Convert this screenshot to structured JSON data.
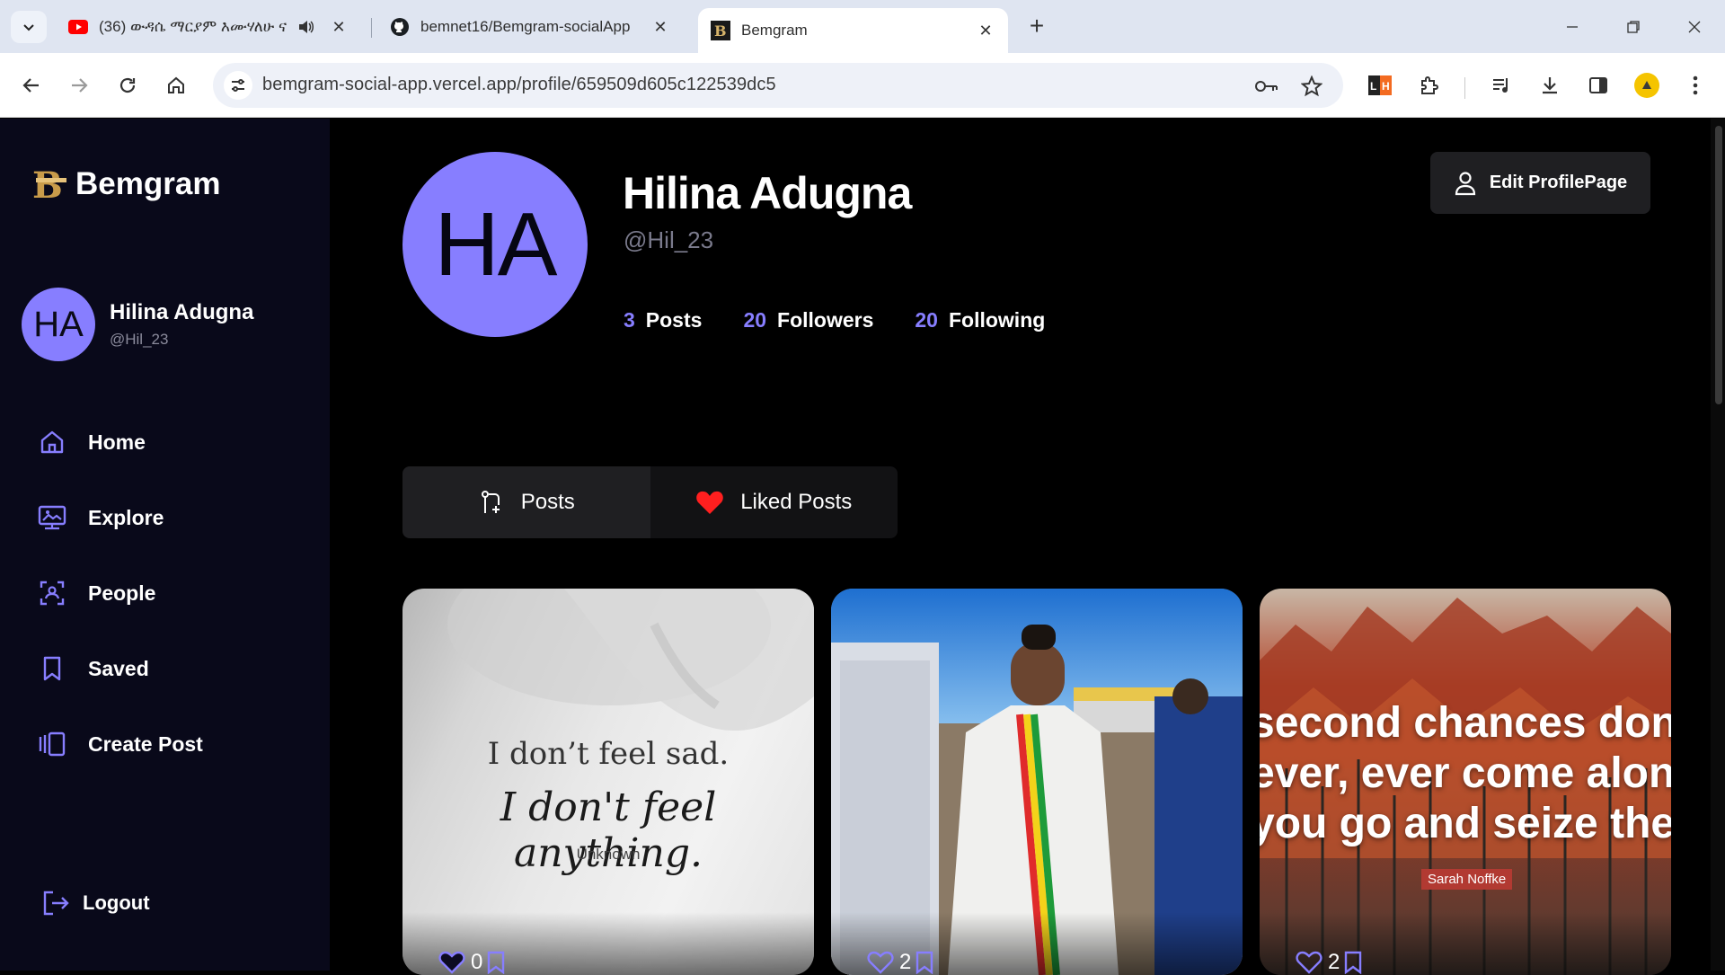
{
  "browser": {
    "tabs": [
      {
        "title": "(36) ውዳሴ ማርያም እሙሃለሁ ና",
        "favicon": "youtube-icon"
      },
      {
        "title": "bemnet16/Bemgram-socialApp",
        "favicon": "github-icon"
      },
      {
        "title": "Bemgram",
        "favicon": "bemgram-icon"
      }
    ],
    "url": "bemgram-social-app.vercel.app/profile/659509d605c122539dc5",
    "colors": {
      "tabbar": "#dfe5f1",
      "omnibox": "#eef1f8"
    }
  },
  "sidebar": {
    "brand": "Bemgram",
    "user": {
      "initials": "HA",
      "name": "Hilina Adugna",
      "handle": "@Hil_23"
    },
    "items": [
      {
        "label": "Home",
        "icon": "home-icon"
      },
      {
        "label": "Explore",
        "icon": "explore-icon"
      },
      {
        "label": "People",
        "icon": "people-icon"
      },
      {
        "label": "Saved",
        "icon": "bookmark-icon"
      },
      {
        "label": "Create Post",
        "icon": "create-post-icon"
      }
    ],
    "logout": "Logout"
  },
  "profile": {
    "initials": "HA",
    "name": "Hilina Adugna",
    "handle": "@Hil_23",
    "stats": [
      {
        "value": "3",
        "label": "Posts"
      },
      {
        "value": "20",
        "label": "Followers"
      },
      {
        "value": "20",
        "label": "Following"
      }
    ],
    "edit_label": "Edit ProfilePage",
    "tabs": [
      {
        "label": "Posts",
        "icon": "posts-icon"
      },
      {
        "label": "Liked Posts",
        "icon": "heart-icon"
      }
    ],
    "posts": [
      {
        "likes": "0",
        "lines": [
          "I don’t feel sad.",
          "I don't feel anything.",
          "Unknown"
        ]
      },
      {
        "likes": "2"
      },
      {
        "likes": "2",
        "lines": [
          "second chances don't",
          "ever, ever come along",
          "you go and seize them"
        ],
        "author": "Sarah Noffke"
      }
    ]
  },
  "colors": {
    "accent": "#877eff",
    "sidebar": "#09091a",
    "card": "#1f1f22"
  }
}
